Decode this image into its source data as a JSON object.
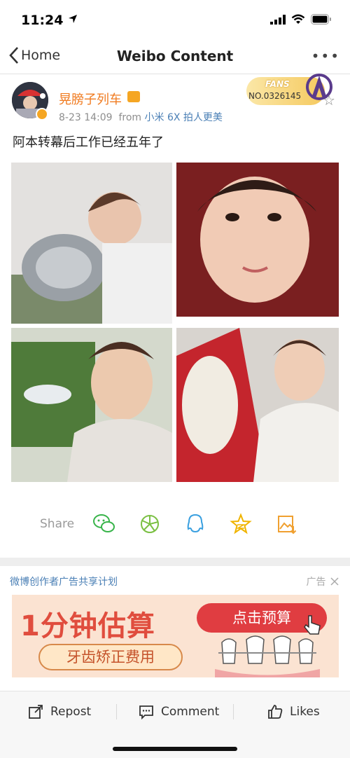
{
  "status_bar": {
    "time": "11:24"
  },
  "nav": {
    "back_label": "Home",
    "title": "Weibo Content",
    "more": "•••"
  },
  "post": {
    "username": "晃膀子列车",
    "time": "8-23 14:09",
    "from_label": "from",
    "source": "小米 6X 拍人更美",
    "fans_label": "FANS",
    "fans_no": "NO.0326145",
    "text": "阿本转幕后工作已经五年了",
    "photo_count": 4
  },
  "share": {
    "label": "Share",
    "targets": [
      "wechat-icon",
      "moments-icon",
      "qq-icon",
      "qzone-icon",
      "save-image-icon"
    ]
  },
  "ad": {
    "title": "微博创作者广告共享计划",
    "tag": "广告",
    "headline": "1分钟估算",
    "pill": "牙齿矫正费用",
    "cta": "点击预算"
  },
  "actions": {
    "repost": "Repost",
    "comment": "Comment",
    "likes": "Likes"
  },
  "colors": {
    "username": "#f07b20",
    "link": "#4a7fb5",
    "ad_red": "#e03d41"
  }
}
